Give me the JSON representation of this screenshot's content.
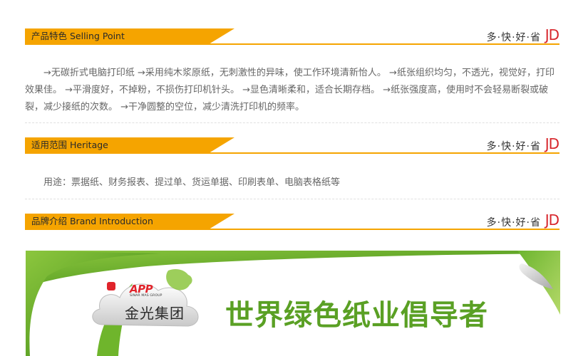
{
  "sections": [
    {
      "title": "产品特色 Selling Point",
      "slogan": "多·快·好·省",
      "logo": "JD",
      "body": "　　→无碳折式电脑打印纸 →采用纯木浆原纸，无刺激性的异味，使工作环境清新怡人。 →纸张组织均匀，不透光，视觉好，打印效果佳。 →平滑度好，不掉粉，不损伤打印机针头。 →显色清晰柔和，适合长期存档。 →纸张强度高，使用时不会轻易断裂或破裂，减少接纸的次数。 →干净圆整的空位，减少清洗打印机的频率。"
    },
    {
      "title": "适用范围 Heritage",
      "slogan": "多·快·好·省",
      "logo": "JD",
      "body": "　　用途：票据纸、财务报表、提过单、货运单据、印刷表单、电脑表格纸等"
    },
    {
      "title": "品牌介绍 Brand Introduction",
      "slogan": "多·快·好·省",
      "logo": "JD"
    }
  ],
  "banner": {
    "slogan": "世界绿色纸业倡导者",
    "app_logo": "APP",
    "app_sub": "SINAR MAS GROUP",
    "brand_name": "金光集团"
  },
  "colors": {
    "accent": "#f5a400",
    "jd_red": "#d7252b",
    "banner_green": "#5aa024"
  }
}
